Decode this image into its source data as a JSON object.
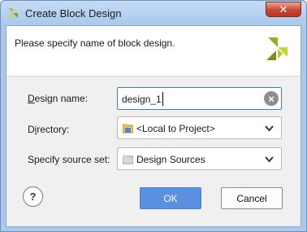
{
  "window": {
    "title": "Create Block Design",
    "close_label": "✕"
  },
  "header": {
    "message": "Please specify name of block design."
  },
  "form": {
    "design_name": {
      "label_first": "D",
      "label_rest": "esign name:",
      "value": "design_1"
    },
    "directory": {
      "label_first": "D",
      "label_mid": "i",
      "label_rest": "rectory:",
      "value": "<Local to Project>"
    },
    "source_set": {
      "label": "Specify source set:",
      "value": "Design Sources"
    }
  },
  "buttons": {
    "help": "?",
    "ok": "OK",
    "cancel": "Cancel"
  },
  "colors": {
    "accent": "#5b8fe0",
    "focus_border": "#3d7bd8",
    "close": "#c94532"
  },
  "icons": {
    "title": "vivado-logo-icon",
    "header": "vivado-logo-icon",
    "clear": "clear-icon",
    "directory": "folder-icon",
    "source": "folder-icon",
    "dropdown": "chevron-down-icon"
  }
}
